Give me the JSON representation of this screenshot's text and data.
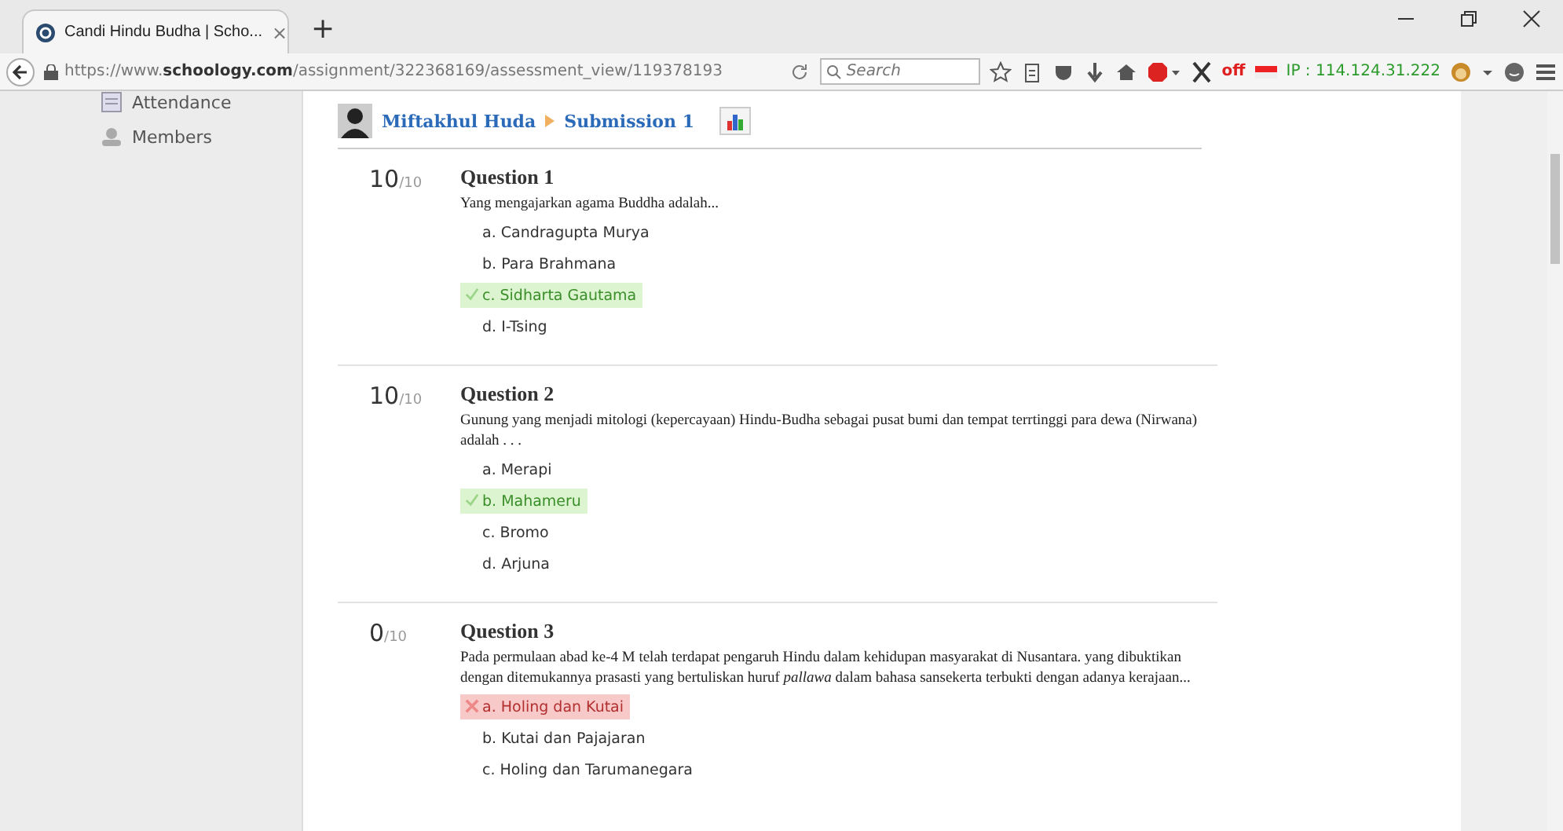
{
  "browser": {
    "tab_title": "Candi Hindu Budha | Scho...",
    "tab_close": "×",
    "new_tab": "+",
    "url_prefix": "https://www.",
    "url_host": "schoology.com",
    "url_path": "/assignment/322368169/assessment_view/119378193",
    "search_placeholder": "Search",
    "proxy_state": "off",
    "ip_text": "IP : 114.124.31.222"
  },
  "sidebar": {
    "items": [
      {
        "label": "Attendance",
        "kind": "attendance"
      },
      {
        "label": "Members",
        "kind": "members"
      }
    ]
  },
  "header": {
    "student": "Miftakhul Huda",
    "submission": "Submission 1"
  },
  "questions": [
    {
      "score": "10",
      "max": "/10",
      "title": "Question 1",
      "text": "Yang mengajarkan agama Buddha adalah...",
      "options": [
        {
          "label": "a. Candragupta Murya",
          "correct": false,
          "wrong": false
        },
        {
          "label": "b. Para Brahmana",
          "correct": false,
          "wrong": false
        },
        {
          "label": "c. Sidharta Gautama",
          "correct": true,
          "wrong": false
        },
        {
          "label": "d. I-Tsing",
          "correct": false,
          "wrong": false
        }
      ]
    },
    {
      "score": "10",
      "max": "/10",
      "title": "Question 2",
      "text": "Gunung yang menjadi mitologi (kepercayaan) Hindu-Budha sebagai pusat bumi dan tempat terrtinggi para dewa (Nirwana) adalah . . .",
      "options": [
        {
          "label": "a. Merapi",
          "correct": false,
          "wrong": false
        },
        {
          "label": "b. Mahameru",
          "correct": true,
          "wrong": false
        },
        {
          "label": "c. Bromo",
          "correct": false,
          "wrong": false
        },
        {
          "label": "d. Arjuna",
          "correct": false,
          "wrong": false
        }
      ]
    },
    {
      "score": "0",
      "max": "/10",
      "title": "Question 3",
      "text": "Pada permulaan abad ke-4 M telah terdapat pengaruh Hindu dalam kehidupan masyarakat di Nusantara. yang dibuktikan dengan ditemukannya prasasti yang bertuliskan huruf *pallawa* dalam bahasa sansekerta terbukti dengan adanya kerajaan...",
      "options": [
        {
          "label": "a. Holing dan Kutai",
          "correct": false,
          "wrong": true
        },
        {
          "label": "b. Kutai dan Pajajaran",
          "correct": false,
          "wrong": false
        },
        {
          "label": "c. Holing dan Tarumanegara",
          "correct": false,
          "wrong": false
        }
      ]
    }
  ]
}
